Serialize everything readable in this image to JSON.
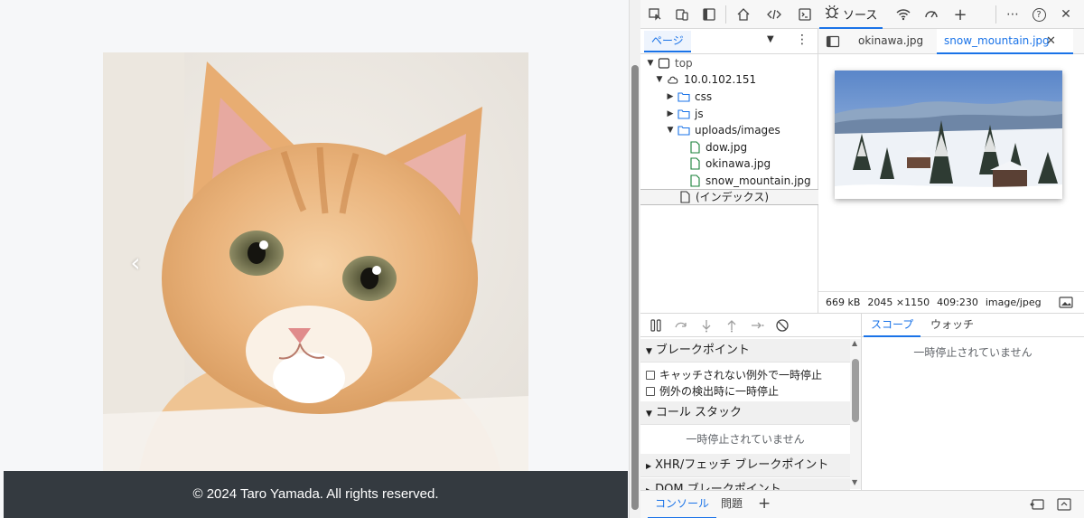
{
  "webpage": {
    "footer_text": "© 2024 Taro Yamada. All rights reserved.",
    "prev_arrow": "‹",
    "image_icon": "cat-photo"
  },
  "devtools": {
    "toolbar": {
      "icons": [
        "inspect-icon",
        "device-toolbar-icon",
        "dock-icon",
        "home-icon",
        "elements-icon",
        "console-icon",
        "sources-bug-icon",
        "network-wifi-icon",
        "performance-icon",
        "add-tab-icon",
        "more-icon",
        "help-icon",
        "close-icon"
      ],
      "sources_label": "ソース",
      "more": "⋯",
      "help": "?",
      "close": "✕",
      "add": "+"
    },
    "navigator": {
      "tab_label": "ページ",
      "tree": {
        "top": "top",
        "host": "10.0.102.151",
        "css": "css",
        "js": "js",
        "uploads": "uploads/images",
        "file1": "dow.jpg",
        "file2": "okinawa.jpg",
        "file3": "snow_mountain.jpg",
        "index": "(インデックス)"
      }
    },
    "editor": {
      "tabs": [
        {
          "label": "okinawa.jpg"
        },
        {
          "label": "snow_mountain.jpg"
        }
      ],
      "close_glyph": "✕",
      "image_info": {
        "size": "669 kB",
        "dimensions": "2045 ×1150",
        "cursor": "409:230",
        "mime": "image/jpeg"
      }
    },
    "debugger": {
      "breakpoints_title": "ブレークポイント",
      "uncaught_label": "キャッチされない例外で一時停止",
      "caught_label": "例外の検出時に一時停止",
      "callstack_title": "コール スタック",
      "not_paused": "一時停止されていません",
      "xhr_title": "XHR/フェッチ ブレークポイント",
      "dom_title": "DOM ブレークポイント"
    },
    "scope": {
      "tabs": [
        "スコープ",
        "ウォッチ"
      ],
      "empty": "一時停止されていません"
    },
    "drawer": {
      "tabs": [
        "コンソール",
        "問題"
      ],
      "add": "+"
    }
  }
}
